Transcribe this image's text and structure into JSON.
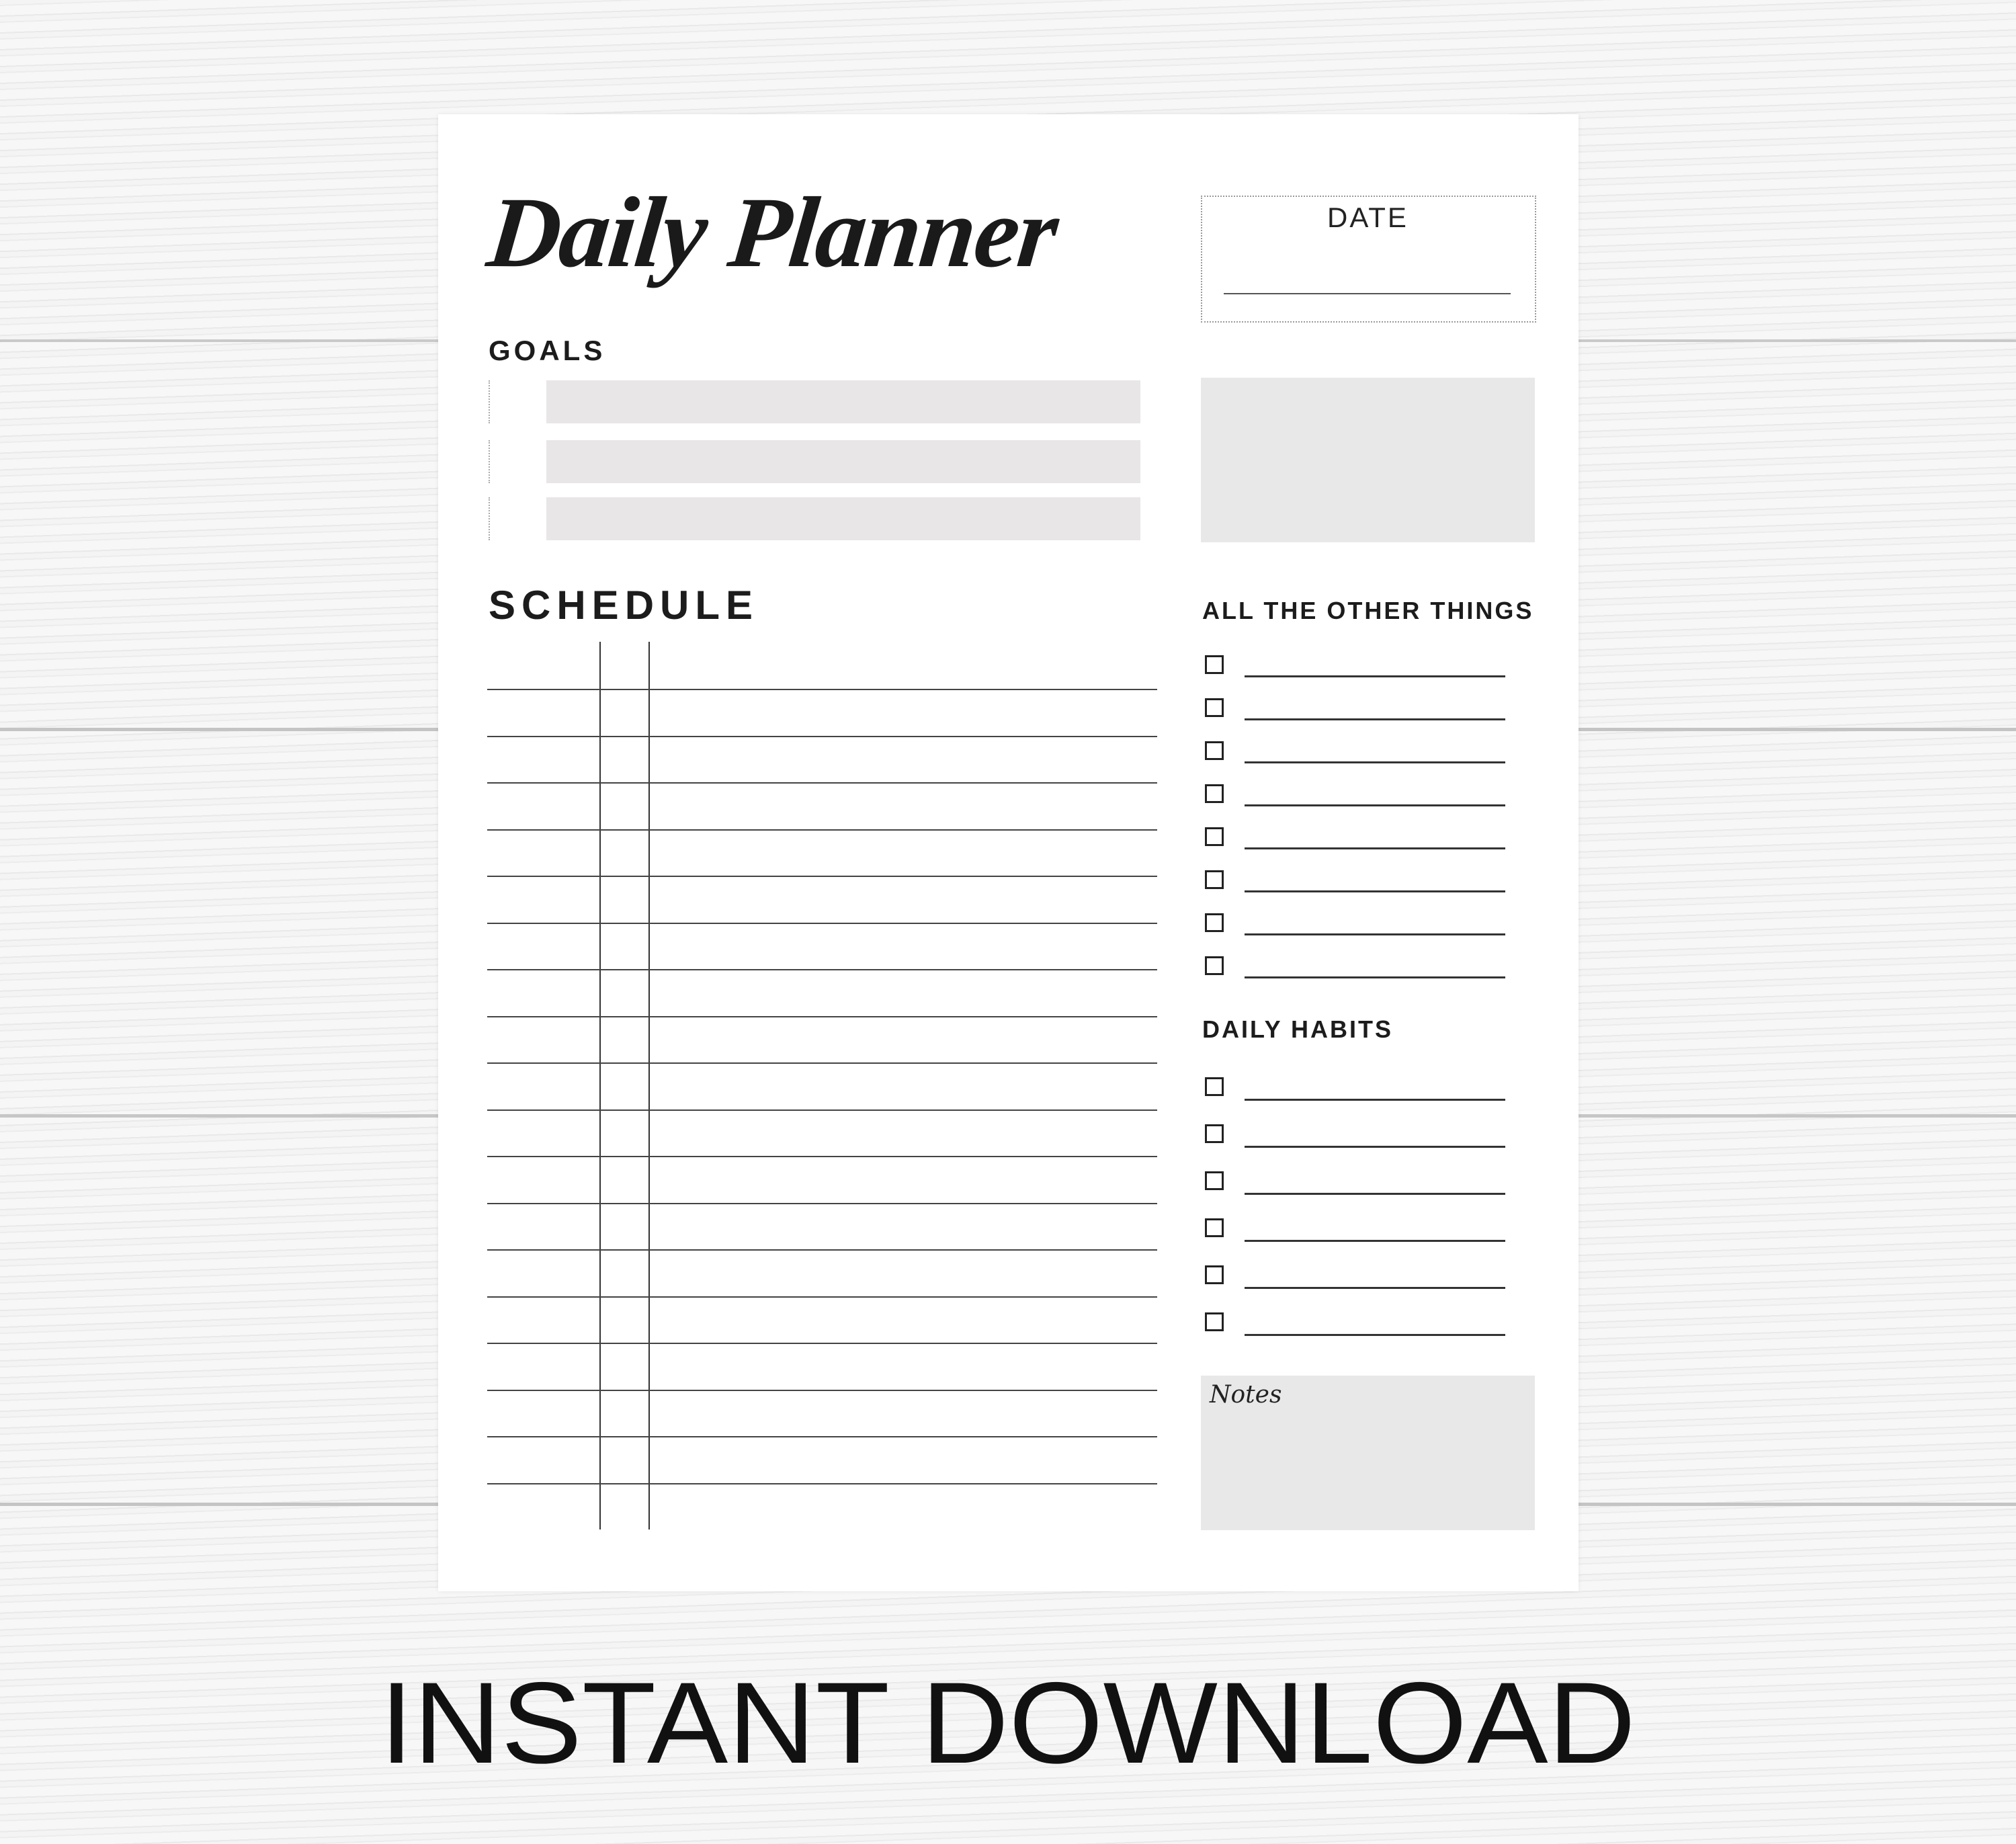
{
  "planner": {
    "title": "Daily Planner",
    "date_label": "DATE",
    "goals_heading": "GOALS",
    "schedule_heading": "SCHEDULE",
    "other_things_heading": "ALL THE OTHER THINGS",
    "daily_habits_heading": "DAILY HABITS",
    "notes_label": "Notes"
  },
  "footer": {
    "text": "INSTANT DOWNLOAD"
  },
  "colors": {
    "panel_gray": "#e8e8e8",
    "ink": "#1c1c1c",
    "paper": "#ffffff"
  }
}
